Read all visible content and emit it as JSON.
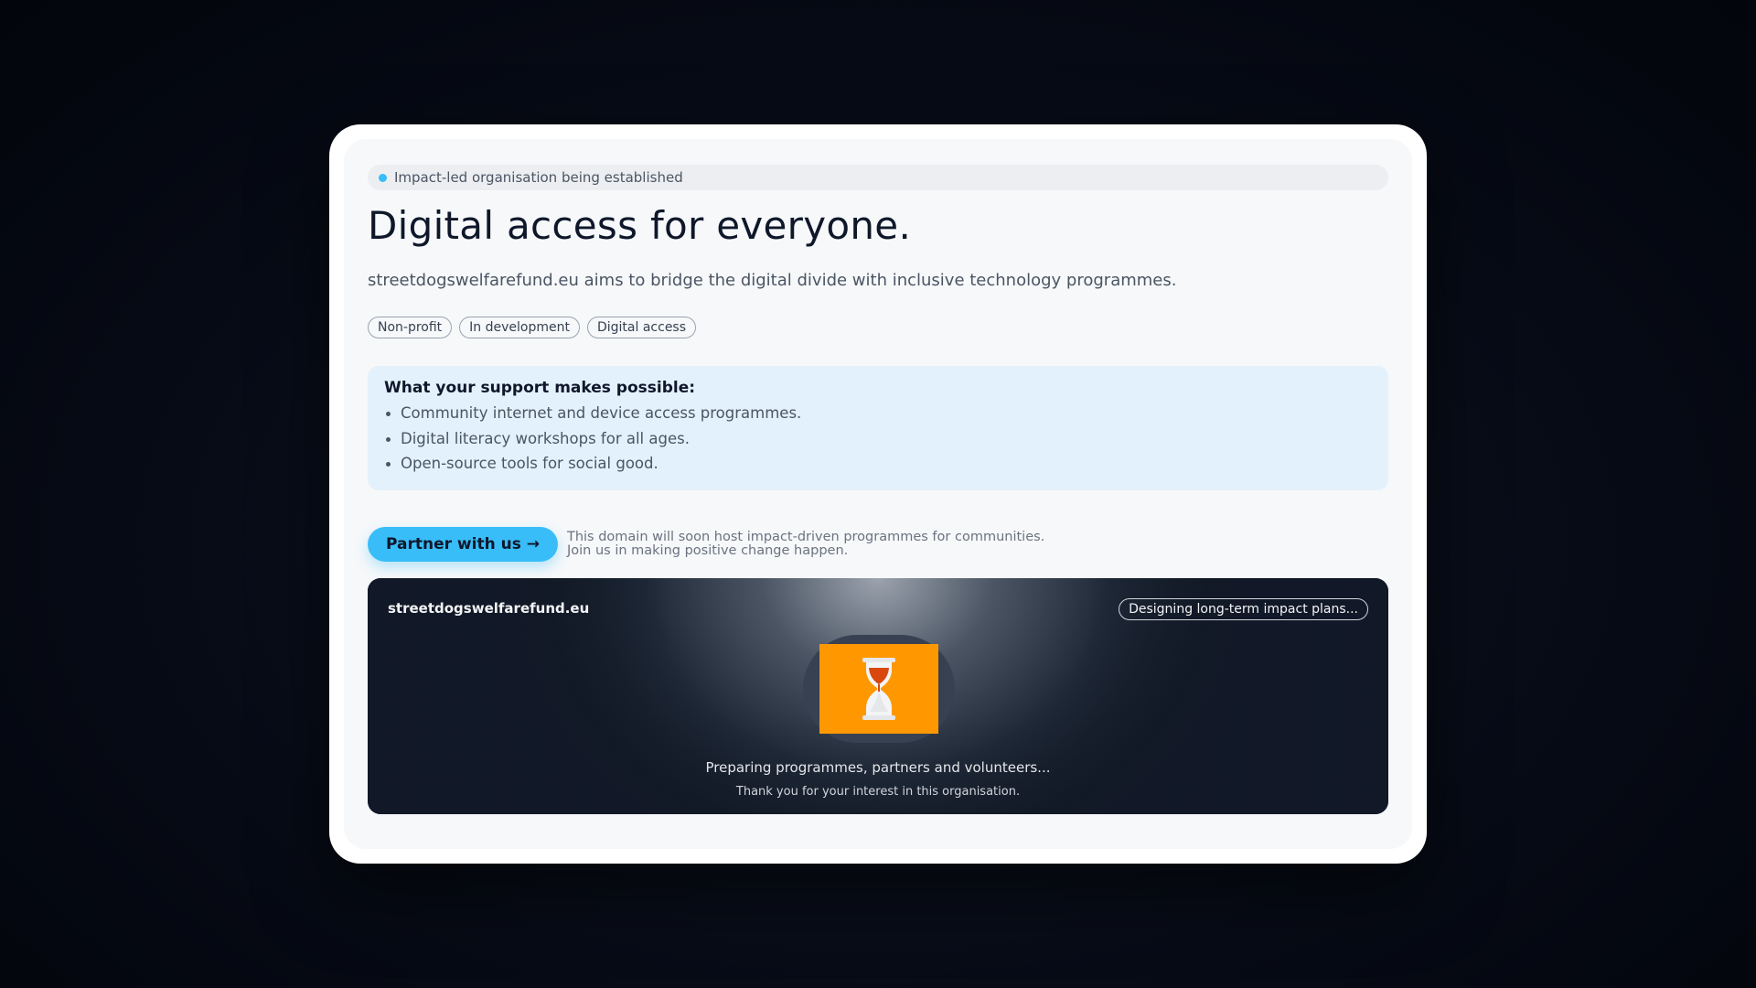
{
  "status": {
    "text": "Impact-led organisation being established",
    "dot_color": "#38bdf8"
  },
  "hero": {
    "title": "Digital access for everyone.",
    "subtitle": "streetdogswelfarefund.eu aims to bridge the digital divide with inclusive technology programmes."
  },
  "tags": [
    "Non-profit",
    "In development",
    "Digital access"
  ],
  "support": {
    "heading": "What your support makes possible:",
    "items": [
      "Community internet and device access programmes.",
      "Digital literacy workshops for all ages.",
      "Open-source tools for social good."
    ]
  },
  "cta": {
    "button_label": "Partner with us →",
    "note_line1": "This domain will soon host impact-driven programmes for communities.",
    "note_line2": "Join us in making positive change happen.",
    "accent_color": "#38bdf8"
  },
  "panel": {
    "domain": "streetdogswelfarefund.eu",
    "badge": "Designing long-term impact plans...",
    "icon": "hourglass-icon",
    "icon_bg_color": "#ff9800",
    "line1": "Preparing programmes, partners and volunteers...",
    "line2": "Thank you for your interest in this organisation."
  }
}
